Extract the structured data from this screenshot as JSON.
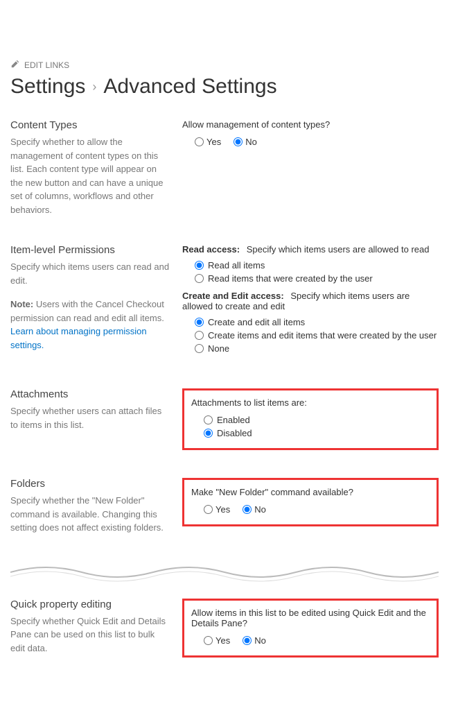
{
  "edit_links_label": "EDIT LINKS",
  "breadcrumb": {
    "part1": "Settings",
    "part2": "Advanced Settings"
  },
  "sections": {
    "content_types": {
      "title": "Content Types",
      "desc": "Specify whether to allow the management of content types on this list. Each content type will appear on the new button and can have a unique set of columns, workflows and other behaviors.",
      "question": "Allow management of content types?",
      "yes": "Yes",
      "no": "No"
    },
    "item_level": {
      "title": "Item-level Permissions",
      "desc1": "Specify which items users can read and edit.",
      "note_prefix": "Note:",
      "note_body": " Users with the Cancel Checkout permission can read and edit all items. ",
      "link": "Learn about managing permission settings.",
      "read_heading": "Read access:",
      "read_help": "Specify which items users are allowed to read",
      "read_opt1": "Read all items",
      "read_opt2": "Read items that were created by the user",
      "create_heading": "Create and Edit access:",
      "create_help": "Specify which items users are allowed to create and edit",
      "create_opt1": "Create and edit all items",
      "create_opt2": "Create items and edit items that were created by the user",
      "create_opt3": "None"
    },
    "attachments": {
      "title": "Attachments",
      "desc": "Specify whether users can attach files to items in this list.",
      "question": "Attachments to list items are:",
      "opt1": "Enabled",
      "opt2": "Disabled"
    },
    "folders": {
      "title": "Folders",
      "desc": "Specify whether the \"New Folder\" command is available. Changing this setting does not affect existing folders.",
      "question": "Make \"New Folder\" command available?",
      "yes": "Yes",
      "no": "No"
    },
    "quick_edit": {
      "title": "Quick property editing",
      "desc": "Specify whether Quick Edit and Details Pane can be used on this list to bulk edit data.",
      "question": "Allow items in this list to be edited using Quick Edit and the Details Pane?",
      "yes": "Yes",
      "no": "No"
    }
  }
}
